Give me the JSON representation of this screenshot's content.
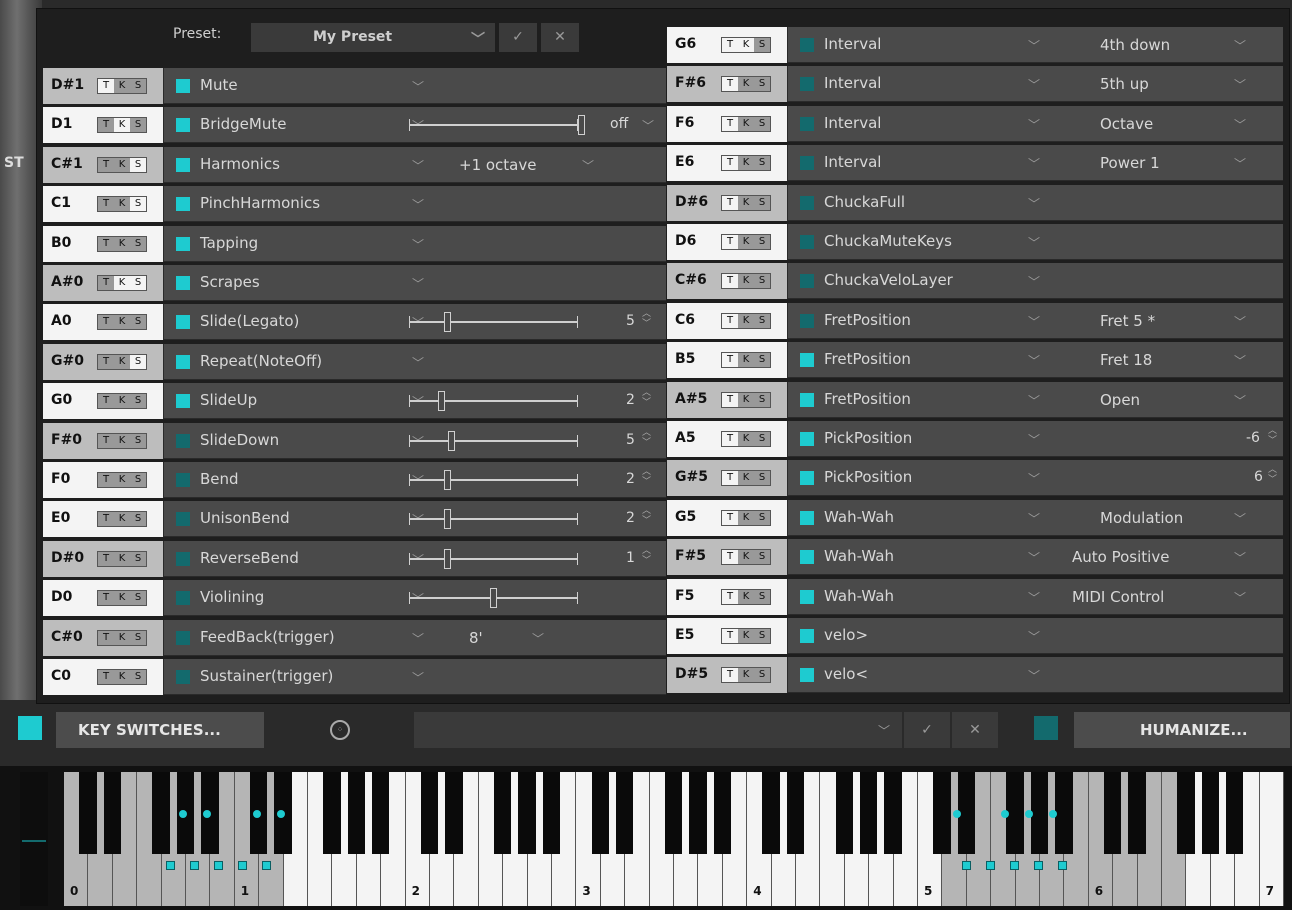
{
  "header": {
    "preset_label": "Preset:",
    "preset_value": "My Preset",
    "confirm_icon": "check-icon",
    "cancel_icon": "close-icon"
  },
  "bg_text": "ST",
  "tks": [
    "T",
    "K",
    "S"
  ],
  "left_rows": [
    {
      "note": "D#1",
      "key": "grey",
      "tks": [
        true,
        false,
        false
      ],
      "name": "Mute",
      "active": true
    },
    {
      "note": "D1",
      "key": "white",
      "tks": [
        false,
        true,
        false
      ],
      "name": "BridgeMute",
      "active": true,
      "value": "off"
    },
    {
      "note": "C#1",
      "key": "grey",
      "tks": [
        false,
        false,
        true
      ],
      "name": "Harmonics",
      "active": true,
      "option": "+1 octave"
    },
    {
      "note": "C1",
      "key": "white",
      "tks": [
        false,
        false,
        true
      ],
      "name": "PinchHarmonics",
      "active": true
    },
    {
      "note": "B0",
      "key": "white",
      "tks": [
        false,
        false,
        false
      ],
      "name": "Tapping",
      "active": true
    },
    {
      "note": "A#0",
      "key": "grey",
      "tks": [
        false,
        true,
        true
      ],
      "name": "Scrapes",
      "active": true
    },
    {
      "note": "A0",
      "key": "white",
      "tks": [
        false,
        false,
        false
      ],
      "name": "Slide(Legato)",
      "active": true,
      "value": "5"
    },
    {
      "note": "G#0",
      "key": "grey",
      "tks": [
        false,
        false,
        true
      ],
      "name": "Repeat(NoteOff)",
      "active": true
    },
    {
      "note": "G0",
      "key": "white",
      "tks": [
        false,
        false,
        false
      ],
      "name": "SlideUp",
      "active": true,
      "value": "2"
    },
    {
      "note": "F#0",
      "key": "grey",
      "tks": [
        false,
        false,
        false
      ],
      "name": "SlideDown",
      "active": false,
      "value": "5"
    },
    {
      "note": "F0",
      "key": "white",
      "tks": [
        false,
        false,
        false
      ],
      "name": "Bend",
      "active": false,
      "value": "2"
    },
    {
      "note": "E0",
      "key": "white",
      "tks": [
        false,
        false,
        false
      ],
      "name": "UnisonBend",
      "active": false,
      "value": "2"
    },
    {
      "note": "D#0",
      "key": "grey",
      "tks": [
        false,
        false,
        false
      ],
      "name": "ReverseBend",
      "active": false,
      "value": "1"
    },
    {
      "note": "D0",
      "key": "white",
      "tks": [
        false,
        false,
        false
      ],
      "name": "Violining",
      "active": false
    },
    {
      "note": "C#0",
      "key": "grey",
      "tks": [
        false,
        false,
        false
      ],
      "name": "FeedBack(trigger)",
      "active": false,
      "option": "8'"
    },
    {
      "note": "C0",
      "key": "white",
      "tks": [
        false,
        false,
        false
      ],
      "name": "Sustainer(trigger)",
      "active": false
    }
  ],
  "right_rows": [
    {
      "note": "G6",
      "key": "white",
      "tks": [
        true,
        true,
        false
      ],
      "name": "Interval",
      "active": false,
      "option": "4th down"
    },
    {
      "note": "F#6",
      "key": "grey",
      "tks": [
        true,
        false,
        false
      ],
      "name": "Interval",
      "active": false,
      "option": "5th up"
    },
    {
      "note": "F6",
      "key": "white",
      "tks": [
        true,
        false,
        false
      ],
      "name": "Interval",
      "active": false,
      "option": "Octave"
    },
    {
      "note": "E6",
      "key": "white",
      "tks": [
        true,
        false,
        false
      ],
      "name": "Interval",
      "active": false,
      "option": "Power 1"
    },
    {
      "note": "D#6",
      "key": "grey",
      "tks": [
        true,
        false,
        false
      ],
      "name": "ChuckaFull",
      "active": false
    },
    {
      "note": "D6",
      "key": "white",
      "tks": [
        true,
        false,
        false
      ],
      "name": "ChuckaMuteKeys",
      "active": false
    },
    {
      "note": "C#6",
      "key": "grey",
      "tks": [
        true,
        false,
        false
      ],
      "name": "ChuckaVeloLayer",
      "active": false
    },
    {
      "note": "C6",
      "key": "white",
      "tks": [
        true,
        false,
        false
      ],
      "name": "FretPosition",
      "active": false,
      "option": "Fret 5 *"
    },
    {
      "note": "B5",
      "key": "white",
      "tks": [
        true,
        false,
        false
      ],
      "name": "FretPosition",
      "active": true,
      "option": "Fret 18"
    },
    {
      "note": "A#5",
      "key": "grey",
      "tks": [
        true,
        false,
        false
      ],
      "name": "FretPosition",
      "active": true,
      "option": "Open"
    },
    {
      "note": "A5",
      "key": "white",
      "tks": [
        true,
        false,
        false
      ],
      "name": "PickPosition",
      "active": true,
      "value": "-6"
    },
    {
      "note": "G#5",
      "key": "grey",
      "tks": [
        true,
        false,
        false
      ],
      "name": "PickPosition",
      "active": true,
      "value": "6"
    },
    {
      "note": "G5",
      "key": "white",
      "tks": [
        true,
        false,
        false
      ],
      "name": "Wah-Wah",
      "active": true,
      "option": "Modulation"
    },
    {
      "note": "F#5",
      "key": "grey",
      "tks": [
        true,
        false,
        false
      ],
      "name": "Wah-Wah",
      "active": true,
      "option": "Auto Positive"
    },
    {
      "note": "F5",
      "key": "white",
      "tks": [
        true,
        false,
        false
      ],
      "name": "Wah-Wah",
      "active": true,
      "option": "MIDI Control"
    },
    {
      "note": "E5",
      "key": "white",
      "tks": [
        true,
        false,
        false
      ],
      "name": "velo>",
      "active": true
    },
    {
      "note": "D#5",
      "key": "grey",
      "tks": [
        true,
        false,
        false
      ],
      "name": "velo<",
      "active": true
    }
  ],
  "bottom": {
    "key_switches_label": "KEY SWITCHES...",
    "humanize_label": "HUMANIZE...",
    "midi_icon": "midi-icon",
    "check_icon": "check-icon",
    "close_icon": "close-icon"
  },
  "keyboard": {
    "octave_labels": [
      "0",
      "1",
      "2",
      "3",
      "4",
      "5",
      "6",
      "7"
    ]
  },
  "colors": {
    "accent": "#1ecbd0",
    "accent_dim": "#136a6d"
  }
}
